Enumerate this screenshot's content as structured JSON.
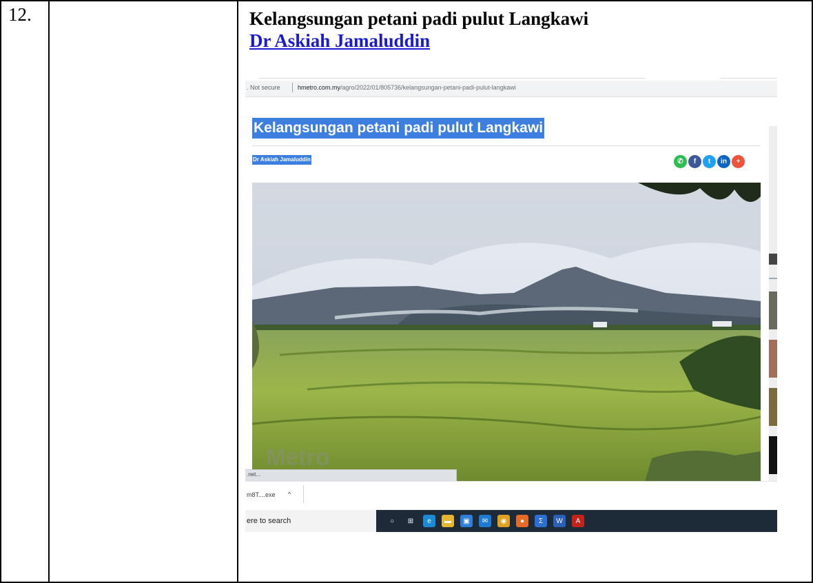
{
  "row": {
    "number": "12.",
    "title": "Kelangsungan petani padi pulut Langkawi",
    "author_link": "Dr Askiah Jamaluddin"
  },
  "browser": {
    "security": ". Not secure",
    "url_domain": "hmetro.com.my",
    "url_path": "/agro/2022/01/805736/kelangsungan-petani-padi-pulut-langkawi"
  },
  "article": {
    "title": "Kelangsungan petani padi pulut Langkawi",
    "author": "Dr Askiah Jamaluddin",
    "share_buttons": [
      {
        "icon": "whatsapp-icon",
        "glyph": "✆",
        "color": "#2dbc4f"
      },
      {
        "icon": "facebook-icon",
        "glyph": "f",
        "color": "#3b5998"
      },
      {
        "icon": "twitter-icon",
        "glyph": "t",
        "color": "#1da1f2"
      },
      {
        "icon": "linkedin-icon",
        "glyph": "in",
        "color": "#0a66c2"
      },
      {
        "icon": "more-share-icon",
        "glyph": "+",
        "color": "#f0523a"
      }
    ],
    "photo_watermark": "Metro"
  },
  "status": {
    "text": ".net..."
  },
  "download": {
    "item": "m8T....exe",
    "chevron": "^"
  },
  "taskbar": {
    "search_text": "ere to search",
    "icons": [
      {
        "name": "cortana-icon",
        "glyph": "○",
        "color": "transparent"
      },
      {
        "name": "task-view-icon",
        "glyph": "⊞",
        "color": "transparent"
      },
      {
        "name": "edge-icon",
        "glyph": "e",
        "color": "#1e8ad6"
      },
      {
        "name": "file-explorer-icon",
        "glyph": "▬",
        "color": "#e8b530"
      },
      {
        "name": "store-icon",
        "glyph": "▣",
        "color": "#2f7fd6"
      },
      {
        "name": "mail-icon",
        "glyph": "✉",
        "color": "#1f7ad1"
      },
      {
        "name": "chrome-icon",
        "glyph": "◉",
        "color": "#e0a020"
      },
      {
        "name": "firefox-icon",
        "glyph": "●",
        "color": "#e66a25"
      },
      {
        "name": "sigma-icon",
        "glyph": "Σ",
        "color": "#2c6fd1"
      },
      {
        "name": "word-icon",
        "glyph": "W",
        "color": "#2b5fb8"
      },
      {
        "name": "acrobat-icon",
        "glyph": "A",
        "color": "#c4231b"
      }
    ]
  }
}
